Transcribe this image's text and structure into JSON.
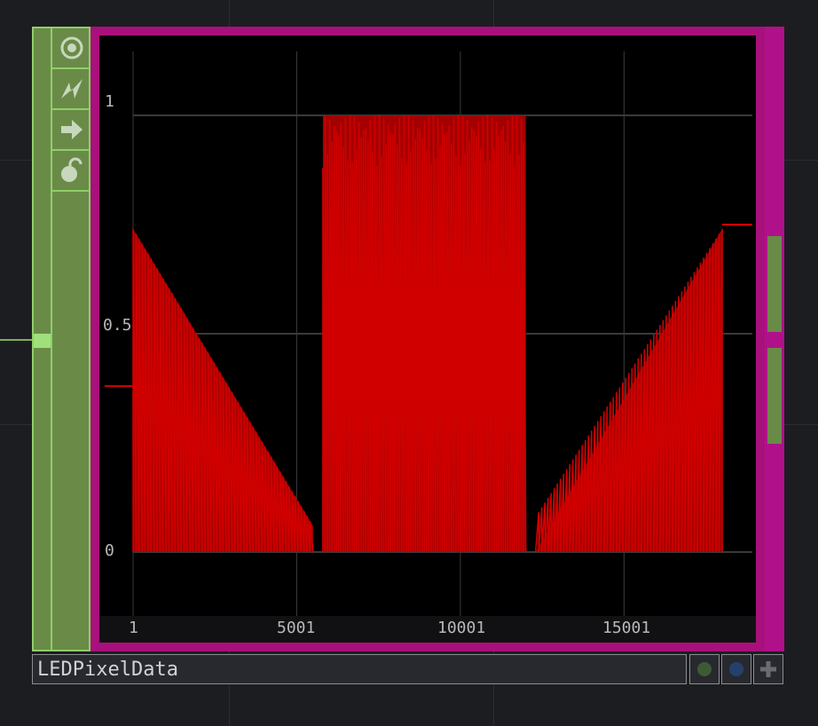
{
  "operator": {
    "name": "LEDPixelData"
  },
  "side_icons": [
    "viewer-active-icon",
    "cook-icon",
    "bypass-arrow-icon",
    "lock-icon"
  ],
  "flags": [
    "display-flag-icon",
    "render-flag-icon",
    "plus-icon"
  ],
  "colors": {
    "frame": "#a8107c",
    "strip": "#6a8b48",
    "trace": "#d00000"
  },
  "chart_data": {
    "type": "line",
    "x_ticks": [
      "1",
      "5001",
      "10001",
      "15001"
    ],
    "y_ticks": [
      "1",
      "0.5",
      "0"
    ],
    "xlim": [
      1,
      18000
    ],
    "ylim": [
      0,
      1
    ],
    "grid": true,
    "segments": [
      {
        "shape": "falling_triangles",
        "x": [
          1,
          5500
        ],
        "y": [
          0.74,
          0.06
        ]
      },
      {
        "shape": "full_range",
        "x": [
          5800,
          12000
        ],
        "y": [
          0,
          1
        ]
      },
      {
        "shape": "rising_triangles",
        "x": [
          12300,
          18000
        ],
        "y": [
          0.08,
          0.74
        ]
      }
    ],
    "end_value": 0.75
  }
}
